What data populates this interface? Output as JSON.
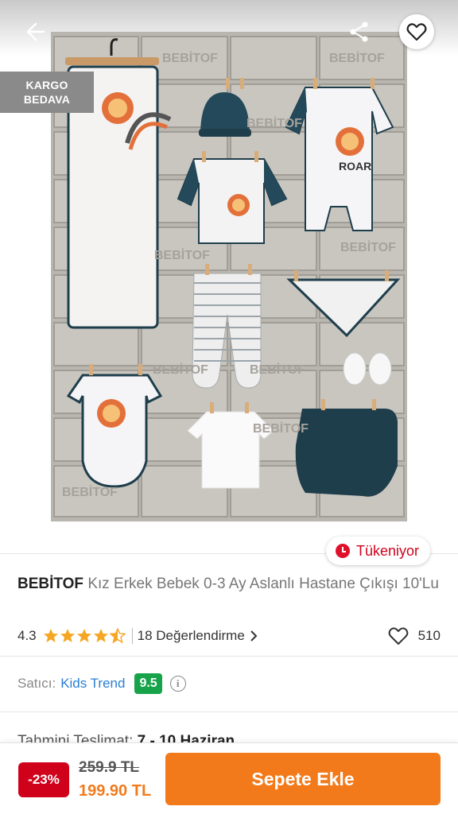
{
  "hero": {
    "cargo_badge_line1": "KARGO",
    "cargo_badge_line2": "BEDAVA",
    "photo_prints": {
      "roar_text": "ROAR",
      "brand_stamp": "BEBİTOF"
    }
  },
  "stock_badge": {
    "label": "Tükeniyor",
    "color": "#d0021b"
  },
  "product": {
    "brand": "BEBİTOF",
    "name": "Kız Erkek Bebek 0-3 Ay Aslanlı  Hastane Çıkışı 10'Lu"
  },
  "rating": {
    "value": "4.3",
    "stars_filled": 4.3,
    "reviews_label": "18 Değerlendirme",
    "favorites_count": "510"
  },
  "seller": {
    "label": "Satıcı:",
    "name": "Kids Trend",
    "score": "9.5"
  },
  "delivery": {
    "label": "Tahmini Teslimat:",
    "value": "7 - 10 Haziran"
  },
  "bottom_bar": {
    "discount": "-23%",
    "old_price": "259.9 TL",
    "new_price": "199.90 TL",
    "cart_button": "Sepete Ekle"
  },
  "colors": {
    "accent_orange": "#f27a1a",
    "discount_red": "#d0021b",
    "seller_link_blue": "#2a7fd4",
    "score_green": "#16a34a",
    "star_gold": "#f5a623"
  },
  "icons": [
    "back-arrow-icon",
    "share-icon",
    "heart-icon",
    "clock-icon",
    "star-icon",
    "chevron-right-icon",
    "info-icon"
  ]
}
